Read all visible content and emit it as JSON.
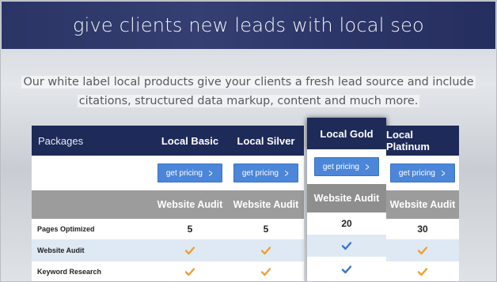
{
  "hero": {
    "title": "give clients new leads with local seo"
  },
  "intro": {
    "line1": "Our white label local products give your clients a fresh lead source and include",
    "line2": "citations, structured data markup, content and much more."
  },
  "table": {
    "packages_label": "Packages",
    "button_label": "get pricing",
    "columns": [
      {
        "name": "Local Basic",
        "audit": "Website Audit",
        "pages": "5",
        "check_color": "#f0a030"
      },
      {
        "name": "Local Silver",
        "audit": "Website Audit",
        "pages": "5",
        "check_color": "#f0a030"
      },
      {
        "name": "Local Gold",
        "audit": "Website Audit",
        "pages": "20",
        "check_color": "#3f73cc"
      },
      {
        "name": "Local Platinum",
        "audit": "Website Audit",
        "pages": "30",
        "check_color": "#f0a030"
      }
    ],
    "rows": [
      "Pages Optimized",
      "Website Audit",
      "Keyword Research"
    ]
  }
}
